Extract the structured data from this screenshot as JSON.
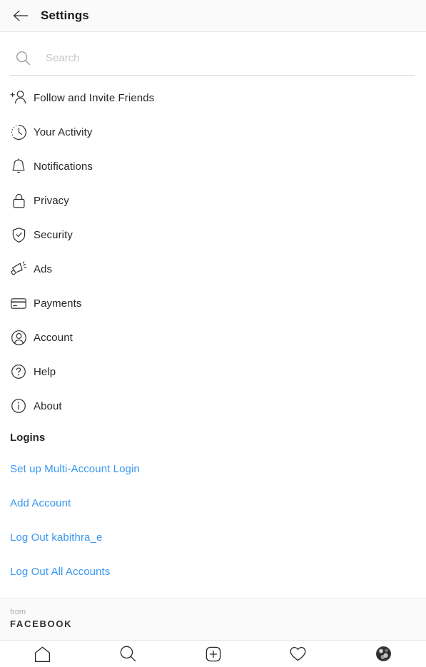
{
  "header": {
    "title": "Settings",
    "back_icon": "arrow-left-icon"
  },
  "search": {
    "placeholder": "Search",
    "value": "",
    "icon": "search-icon"
  },
  "menu": {
    "items": [
      {
        "label": "Follow and Invite Friends",
        "icon": "person-add-icon"
      },
      {
        "label": "Your Activity",
        "icon": "clock-icon"
      },
      {
        "label": "Notifications",
        "icon": "bell-icon"
      },
      {
        "label": "Privacy",
        "icon": "lock-icon"
      },
      {
        "label": "Security",
        "icon": "shield-check-icon"
      },
      {
        "label": "Ads",
        "icon": "megaphone-icon"
      },
      {
        "label": "Payments",
        "icon": "credit-card-icon"
      },
      {
        "label": "Account",
        "icon": "account-circle-icon"
      },
      {
        "label": "Help",
        "icon": "question-circle-icon"
      },
      {
        "label": "About",
        "icon": "info-circle-icon"
      }
    ]
  },
  "logins": {
    "heading": "Logins",
    "links": [
      {
        "label": "Set up Multi-Account Login"
      },
      {
        "label": "Add Account"
      },
      {
        "label": "Log Out kabithra_e"
      },
      {
        "label": "Log Out All Accounts"
      }
    ]
  },
  "brand": {
    "from": "from",
    "name": "FACEBOOK"
  },
  "tabbar": {
    "tabs": [
      {
        "name": "home",
        "icon": "home-icon"
      },
      {
        "name": "search",
        "icon": "search-icon"
      },
      {
        "name": "create",
        "icon": "plus-square-icon"
      },
      {
        "name": "activity",
        "icon": "heart-icon"
      },
      {
        "name": "profile",
        "icon": "avatar-icon"
      }
    ]
  },
  "colors": {
    "link": "#3897f0",
    "text": "#262626",
    "placeholder": "#c7c7c7",
    "header_bg": "#fafafa",
    "divider": "#dbdbdb"
  }
}
